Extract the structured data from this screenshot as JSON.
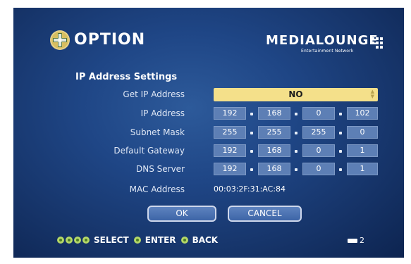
{
  "header": {
    "title": "OPTION",
    "brand": {
      "name": "MEDIALOUNGE",
      "tagline": "Entertainment Network",
      "trademark": "™"
    }
  },
  "section_title": "IP Address Settings",
  "fields": [
    {
      "label": "Get IP Address",
      "type": "select",
      "value": "NO"
    },
    {
      "label": "IP Address",
      "type": "ip",
      "octets": [
        "192",
        "168",
        "0",
        "102"
      ]
    },
    {
      "label": "Subnet Mask",
      "type": "ip",
      "octets": [
        "255",
        "255",
        "255",
        "0"
      ]
    },
    {
      "label": "Default Gateway",
      "type": "ip",
      "octets": [
        "192",
        "168",
        "0",
        "1"
      ]
    },
    {
      "label": "DNS Server",
      "type": "ip",
      "octets": [
        "192",
        "168",
        "0",
        "1"
      ]
    },
    {
      "label": "MAC Address",
      "type": "text",
      "value": "00:03:2F:31:AC:84"
    }
  ],
  "buttons": {
    "ok": "OK",
    "cancel": "CANCEL"
  },
  "footer": {
    "hints": [
      {
        "icon": "arrow-buttons-icon",
        "label": "SELECT"
      },
      {
        "icon": "enter-button-icon",
        "label": "ENTER"
      },
      {
        "icon": "back-button-icon",
        "label": "BACK"
      }
    ],
    "page_number": "2"
  },
  "colors": {
    "background": "#1f4686",
    "selected_field": "#f4e08a",
    "ip_box": "#5d7fb5",
    "hint_button": "#b5d867"
  }
}
